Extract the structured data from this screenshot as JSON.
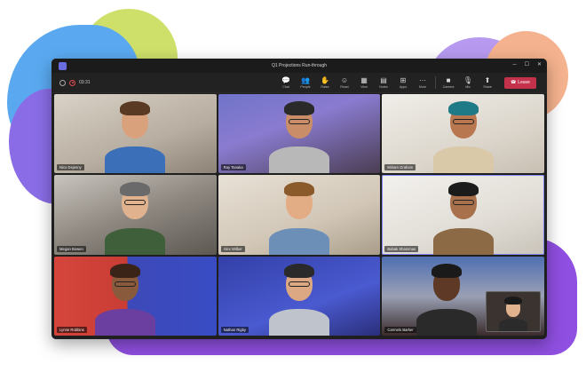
{
  "window": {
    "title": "Q1 Projections Run-through",
    "timer": "03:31"
  },
  "toolbar": [
    {
      "label": "Chat",
      "icon": "chat-icon",
      "glyph": "💬"
    },
    {
      "label": "People",
      "icon": "people-icon",
      "glyph": "👥"
    },
    {
      "label": "Raise",
      "icon": "hand-icon",
      "glyph": "✋"
    },
    {
      "label": "React",
      "icon": "smile-icon",
      "glyph": "☺"
    },
    {
      "label": "View",
      "icon": "grid-icon",
      "glyph": "▦"
    },
    {
      "label": "Notes",
      "icon": "notes-icon",
      "glyph": "▤"
    },
    {
      "label": "Apps",
      "icon": "apps-icon",
      "glyph": "⊞"
    },
    {
      "label": "More",
      "icon": "more-icon",
      "glyph": "···"
    }
  ],
  "media": [
    {
      "label": "Camera",
      "icon": "camera-icon",
      "glyph": "■"
    },
    {
      "label": "Mic",
      "icon": "mic-icon",
      "glyph": "🎙"
    },
    {
      "label": "Share",
      "icon": "share-icon",
      "glyph": "⬆"
    }
  ],
  "leave_label": "Leave",
  "participants": [
    {
      "name": "Nico Dejesny"
    },
    {
      "name": "Ray Tanaka"
    },
    {
      "name": "Miriam Graham"
    },
    {
      "name": "Megan Bowen"
    },
    {
      "name": "Alex Wilber"
    },
    {
      "name": "Babak Shammas"
    },
    {
      "name": "Lynne Robbins"
    },
    {
      "name": "Nathan Rigby"
    },
    {
      "name": "Carmelo Barker"
    }
  ]
}
